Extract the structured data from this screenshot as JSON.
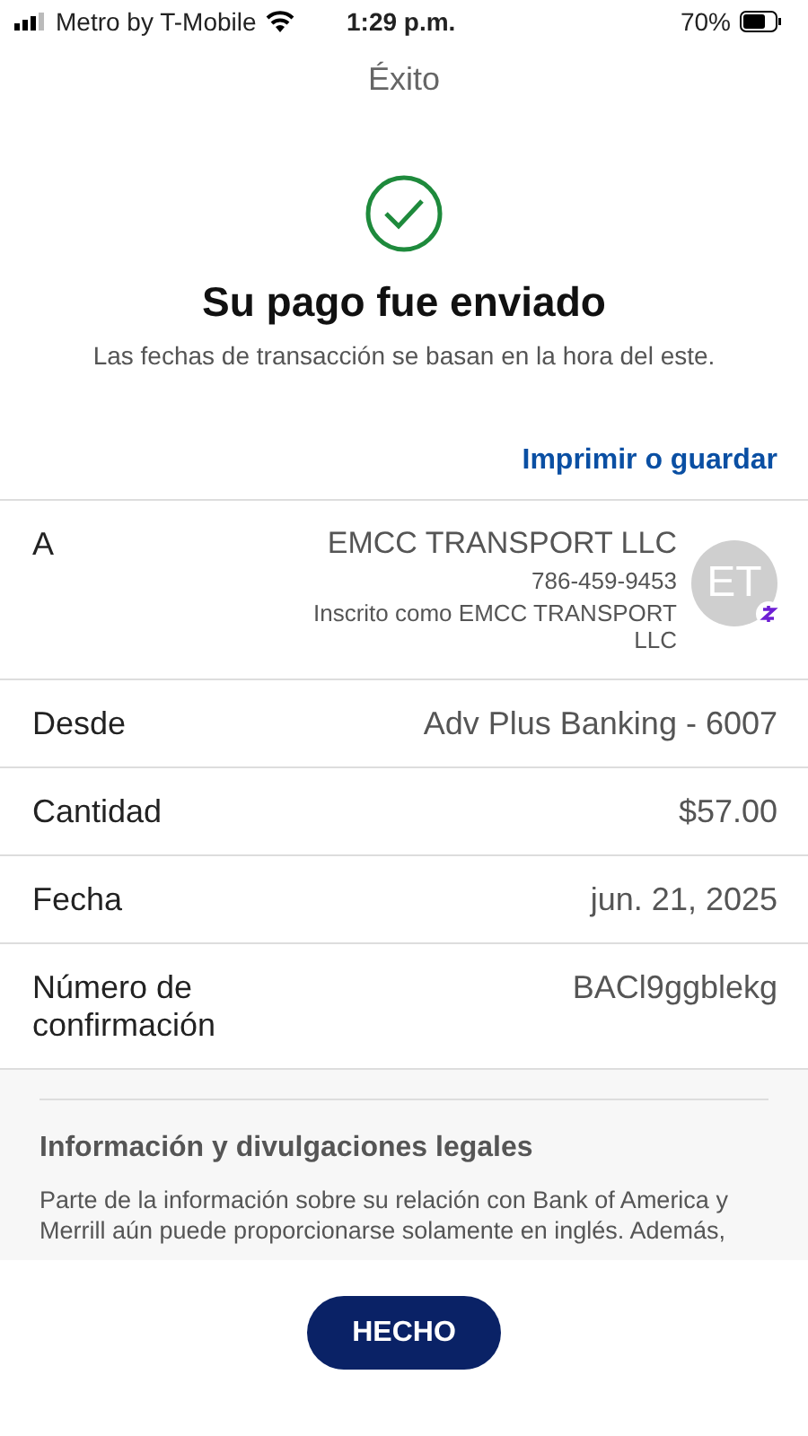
{
  "status_bar": {
    "carrier": "Metro by T-Mobile",
    "time": "1:29 p.m.",
    "battery": "70%"
  },
  "nav": {
    "title": "Éxito"
  },
  "confirmation": {
    "heading": "Su pago fue enviado",
    "subtitle": "Las fechas de transacción se basan en la hora del este.",
    "print_link": "Imprimir o guardar"
  },
  "recipient": {
    "label": "A",
    "name": "EMCC TRANSPORT LLC",
    "phone": "786-459-9453",
    "enrolled": "Inscrito como EMCC TRANSPORT LLC",
    "initials": "ET"
  },
  "details": [
    {
      "label": "Desde",
      "value": "Adv Plus Banking - 6007"
    },
    {
      "label": "Cantidad",
      "value": "$57.00"
    },
    {
      "label": "Fecha",
      "value": "jun. 21, 2025"
    },
    {
      "label": "Número de confirmación",
      "value": "BACl9ggblekg"
    }
  ],
  "legal": {
    "title": "Información y divulgaciones legales",
    "text": "Parte de la información sobre su relación con Bank of America y Merrill aún puede proporcionarse solamente en inglés. Además,"
  },
  "done_button": "HECHO"
}
